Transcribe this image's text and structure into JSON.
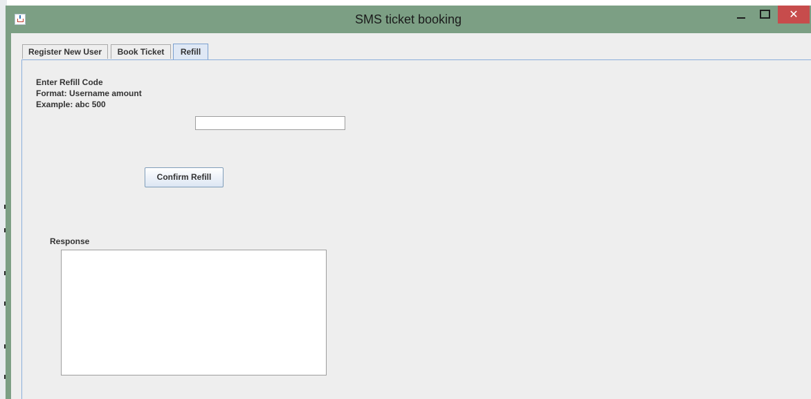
{
  "window": {
    "title": "SMS ticket booking",
    "close_glyph": "✕"
  },
  "tabs": [
    {
      "label": "Register New User",
      "selected": false
    },
    {
      "label": "Book Ticket",
      "selected": false
    },
    {
      "label": "Refill",
      "selected": true
    }
  ],
  "refill_panel": {
    "instructions": [
      "Enter Refill Code",
      "Format: Username amount",
      "Example: abc 500"
    ],
    "code_input_value": "",
    "confirm_label": "Confirm Refill",
    "response_label": "Response",
    "response_value": ""
  },
  "colors": {
    "titlebar": "#7c9f84",
    "close_button": "#c74c4c",
    "panel_bg": "#eeeeee",
    "selected_tab": "#dfe8f5"
  },
  "icons": [
    "java-app-icon",
    "minimize-icon",
    "maximize-icon",
    "close-icon"
  ]
}
